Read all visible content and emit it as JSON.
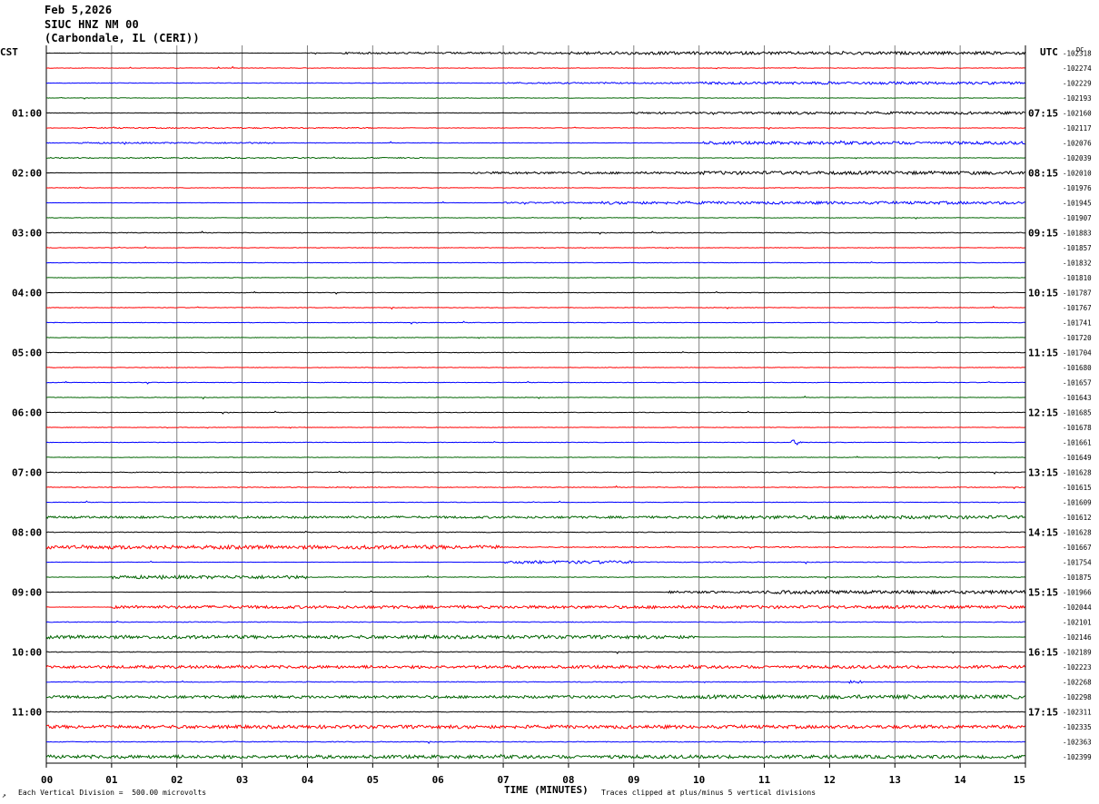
{
  "header": {
    "date": "Feb 5,2026",
    "station": "SIUC HNZ NM 00",
    "location": "(Carbondale, IL (CERI))"
  },
  "left_timezone": "CST",
  "right_timezone": "UTC",
  "dc_label": "DC",
  "footer": {
    "scale_note": "Each Vertical Division =  500.00 microvolts",
    "clip_note": "Traces clipped at plus/minus 5 vertical divisions",
    "corner_mark": "↗"
  },
  "colors": {
    "trace_cycle": [
      "#000000",
      "#ff0000",
      "#0000ff",
      "#006400"
    ],
    "grid": "#808080"
  },
  "chart_data": {
    "type": "line",
    "subtype": "helicorder",
    "title": "SIUC HNZ NM 00",
    "xlabel": "TIME (MINUTES)",
    "x_ticks": [
      "00",
      "01",
      "02",
      "03",
      "04",
      "05",
      "06",
      "07",
      "08",
      "09",
      "10",
      "11",
      "12",
      "13",
      "14",
      "15"
    ],
    "xlim": [
      0,
      15
    ],
    "minutes_per_line": 15,
    "left_hour_labels": [
      "01:00",
      "02:00",
      "03:00",
      "04:00",
      "05:00",
      "06:00",
      "07:00",
      "08:00",
      "09:00",
      "10:00",
      "11:00"
    ],
    "right_hour_labels": [
      "07:15",
      "08:15",
      "09:15",
      "10:15",
      "11:15",
      "12:15",
      "13:15",
      "14:15",
      "15:15",
      "16:15",
      "17:15"
    ],
    "line_dc_offsets": [
      "-102318",
      "-102274",
      "-102229",
      "-102193",
      "-102160",
      "-102117",
      "-102076",
      "-102039",
      "-102010",
      "-101976",
      "-101945",
      "-101907",
      "-101883",
      "-101857",
      "-101832",
      "-101810",
      "-101787",
      "-101767",
      "-101741",
      "-101720",
      "-101704",
      "-101680",
      "-101657",
      "-101643",
      "-101685",
      "-101678",
      "-101661",
      "-101649",
      "-101628",
      "-101615",
      "-101609",
      "-101612",
      "-101628",
      "-101667",
      "-101754",
      "-101875",
      "-101966",
      "-102044",
      "-102101",
      "-102146",
      "-102189",
      "-102223",
      "-102268",
      "-102298",
      "-102311",
      "-102335",
      "-102363",
      "-102399"
    ],
    "noise_segments": [
      [
        [
          0,
          0,
          0.3
        ],
        [
          4.5,
          15,
          1.0
        ],
        [
          8,
          15,
          1.6
        ]
      ],
      [
        [
          0,
          15,
          0.3
        ]
      ],
      [
        [
          0,
          15,
          0.3
        ],
        [
          7,
          15,
          0.8
        ],
        [
          10,
          15,
          1.4
        ]
      ],
      [
        [
          0,
          15,
          0.3
        ]
      ],
      [
        [
          0,
          15,
          0.3
        ],
        [
          9,
          15,
          1.0
        ],
        [
          11,
          15,
          1.4
        ]
      ],
      [
        [
          0,
          15,
          0.3
        ],
        [
          0.5,
          5,
          0.6
        ]
      ],
      [
        [
          0,
          15,
          0.3
        ],
        [
          0.5,
          3.5,
          0.8
        ],
        [
          10,
          15,
          1.6
        ]
      ],
      [
        [
          0,
          5.8,
          0.6
        ],
        [
          5.8,
          15,
          0.3
        ]
      ],
      [
        [
          6.5,
          15,
          1.2
        ],
        [
          10,
          15,
          1.8
        ]
      ],
      [
        [
          0,
          15,
          0.3
        ]
      ],
      [
        [
          7,
          15,
          0.8
        ],
        [
          8.5,
          15,
          1.5
        ]
      ],
      [
        [
          0,
          15,
          0.3
        ]
      ],
      [
        [
          0,
          15,
          0.4
        ]
      ],
      [
        [
          0,
          15,
          0.3
        ]
      ],
      [
        [
          0,
          15,
          0.3
        ]
      ],
      [
        [
          0,
          15,
          0.3
        ]
      ],
      [
        [
          0,
          15,
          0.3
        ]
      ],
      [
        [
          0,
          15,
          0.3
        ]
      ],
      [
        [
          0,
          15,
          0.3
        ]
      ],
      [
        [
          0,
          15,
          0.3
        ]
      ],
      [
        [
          0,
          15,
          0.3
        ]
      ],
      [
        [
          0,
          15,
          0.3
        ]
      ],
      [
        [
          0,
          15,
          0.3
        ]
      ],
      [
        [
          0,
          15,
          0.3
        ]
      ],
      [
        [
          0,
          15,
          0.3
        ]
      ],
      [
        [
          0,
          15,
          0.3
        ]
      ],
      [
        [
          0,
          15,
          0.3
        ],
        [
          11.4,
          11.6,
          3.0
        ]
      ],
      [
        [
          0,
          15,
          0.3
        ]
      ],
      [
        [
          0,
          15,
          0.4
        ]
      ],
      [
        [
          0,
          15,
          0.4
        ]
      ],
      [
        [
          0,
          15,
          0.3
        ]
      ],
      [
        [
          0,
          15,
          1.2
        ],
        [
          10,
          15,
          1.8
        ]
      ],
      [
        [
          0,
          15,
          0.4
        ]
      ],
      [
        [
          0,
          7,
          2.0
        ],
        [
          7,
          15,
          0.5
        ]
      ],
      [
        [
          7,
          9,
          1.6
        ],
        [
          9,
          15,
          0.4
        ]
      ],
      [
        [
          1,
          4,
          1.8
        ],
        [
          4,
          15,
          0.4
        ]
      ],
      [
        [
          9.5,
          15,
          1.2
        ],
        [
          11,
          15,
          1.8
        ]
      ],
      [
        [
          1,
          15,
          1.6
        ]
      ],
      [
        [
          0,
          15,
          0.4
        ]
      ],
      [
        [
          0,
          10,
          1.8
        ]
      ],
      [
        [
          0,
          15,
          0.4
        ]
      ],
      [
        [
          0,
          15,
          1.6
        ]
      ],
      [
        [
          0,
          15,
          0.4
        ],
        [
          12.3,
          12.5,
          1.5
        ]
      ],
      [
        [
          0,
          15,
          1.5
        ],
        [
          10,
          15,
          2.0
        ]
      ],
      [
        [
          0,
          15,
          0.4
        ]
      ],
      [
        [
          0,
          15,
          1.8
        ]
      ],
      [
        [
          0,
          15,
          0.4
        ]
      ],
      [
        [
          0,
          15,
          1.8
        ]
      ]
    ]
  }
}
